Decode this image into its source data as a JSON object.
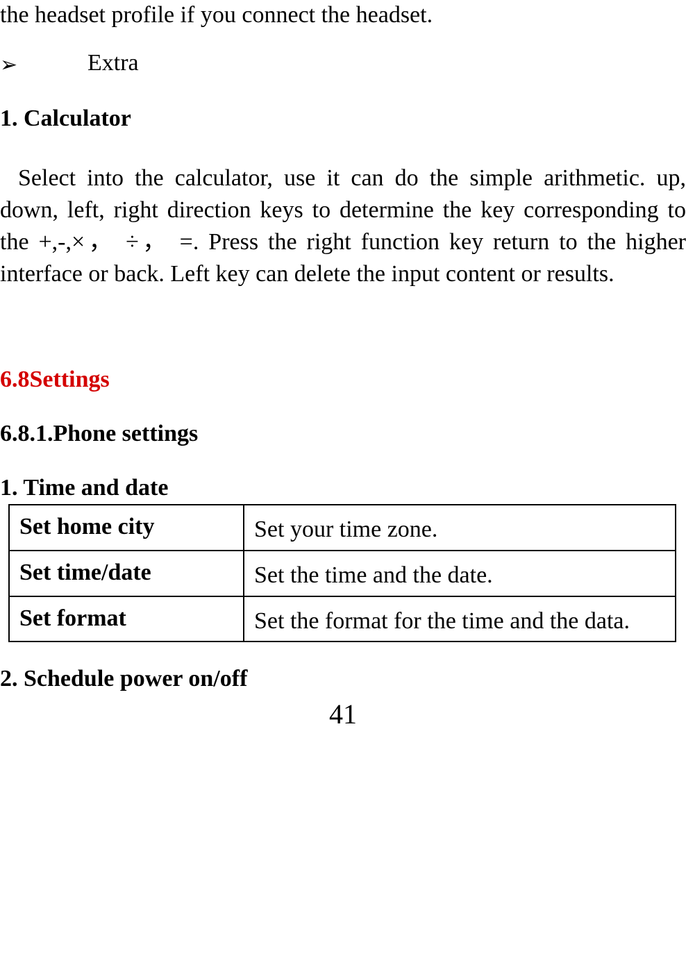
{
  "partial_top_line": "the headset profile if you connect the headset.",
  "bullet": {
    "label": "Extra"
  },
  "section_calculator": {
    "heading": "1. Calculator",
    "paragraph": "Select into the calculator, use it can do the simple arithmetic. up, down, left, right direction keys to determine the key corresponding to the +,-,×， ÷， =. Press the right function key return to the higher interface or back. Left key can delete the input content or results."
  },
  "settings_heading": "6.8Settings",
  "phone_settings_heading": "6.8.1.Phone settings",
  "time_and_date": {
    "heading": "1. Time and date",
    "rows": [
      {
        "label": "Set home city",
        "desc": "Set your time zone."
      },
      {
        "label": "Set time/date",
        "desc": "Set the time and the date."
      },
      {
        "label": "Set format",
        "desc": "Set the format for the time and the data."
      }
    ]
  },
  "schedule_heading": "2. Schedule power on/off",
  "page_number": "41"
}
